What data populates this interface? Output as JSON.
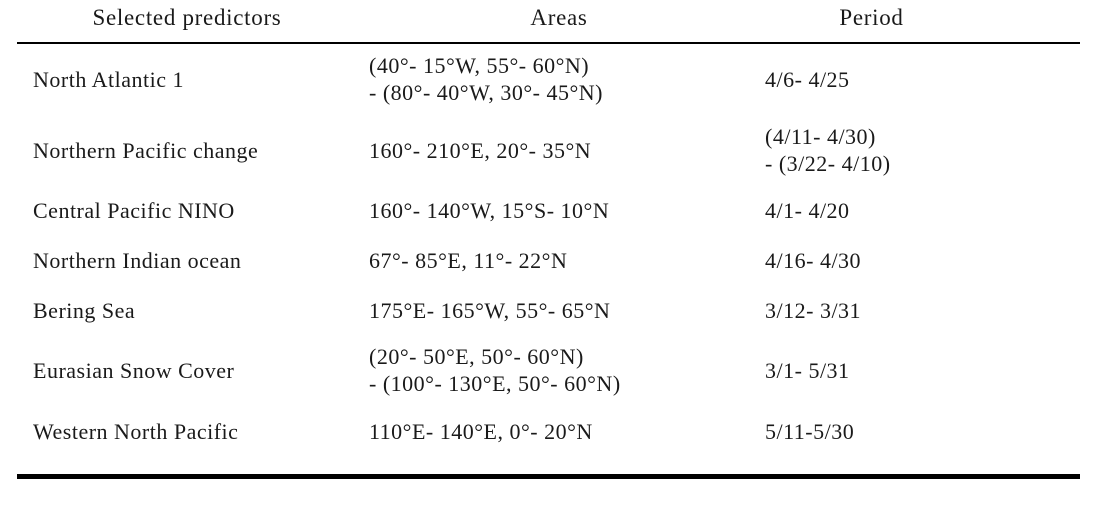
{
  "table": {
    "columns": [
      {
        "key": "predictor",
        "label": "Selected predictors"
      },
      {
        "key": "area",
        "label": "Areas"
      },
      {
        "key": "period",
        "label": "Period"
      }
    ],
    "rows": [
      {
        "predictor": "North Atlantic 1",
        "area_line1": "(40°- 15°W,  55°- 60°N)",
        "area_line2": "- (80°- 40°W,  30°- 45°N)",
        "period_line1": "4/6- 4/25",
        "period_line2": ""
      },
      {
        "predictor": "Northern Pacific change",
        "area_line1": "160°- 210°E,  20°- 35°N",
        "area_line2": "",
        "period_line1": "(4/11- 4/30)",
        "period_line2": "- (3/22- 4/10)"
      },
      {
        "predictor": "Central Pacific NINO",
        "area_line1": "160°- 140°W,  15°S- 10°N",
        "area_line2": "",
        "period_line1": "4/1- 4/20",
        "period_line2": ""
      },
      {
        "predictor": "Northern Indian ocean",
        "area_line1": "67°- 85°E,  11°- 22°N",
        "area_line2": "",
        "period_line1": "4/16- 4/30",
        "period_line2": ""
      },
      {
        "predictor": "Bering Sea",
        "area_line1": "175°E- 165°W,  55°- 65°N",
        "area_line2": "",
        "period_line1": "3/12- 3/31",
        "period_line2": ""
      },
      {
        "predictor": "Eurasian Snow Cover",
        "area_line1": "(20°- 50°E,  50°- 60°N)",
        "area_line2": "- (100°- 130°E,  50°- 60°N)",
        "period_line1": "3/1- 5/31",
        "period_line2": ""
      },
      {
        "predictor": "Western North Pacific",
        "area_line1": "110°E- 140°E,  0°- 20°N",
        "area_line2": "",
        "period_line1": "5/11-5/30",
        "period_line2": ""
      }
    ]
  },
  "style": {
    "text_color": "#1a1a1a",
    "rule_color": "#000000",
    "background": "#ffffff"
  }
}
